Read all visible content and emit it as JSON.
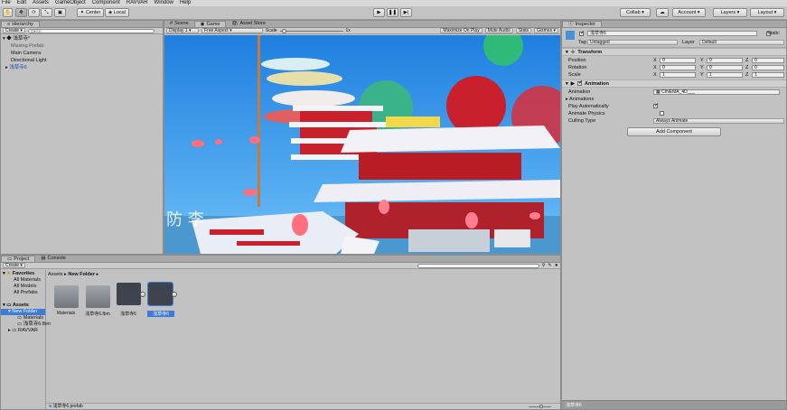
{
  "menu": [
    "File",
    "Edit",
    "Assets",
    "GameObject",
    "Component",
    "RAVVAR",
    "Window",
    "Help"
  ],
  "toolbar": {
    "pivot": "Center",
    "space": "Local",
    "collab": "Collab ▾",
    "account": "Account",
    "layers": "Layers",
    "layout": "Layout"
  },
  "hierarchy": {
    "tab": "Hierarchy",
    "create": "Create",
    "search_placeholder": "Q▾All",
    "scene": "浅草寺*",
    "items": [
      "Missing Prefab",
      "Main Camera",
      "Directional Light",
      "浅草寺6"
    ]
  },
  "scene_tabs": {
    "scene": "Scene",
    "game": "Game",
    "store": "Asset Store"
  },
  "game_bar": {
    "display": "Display 1",
    "aspect": "Free Aspect",
    "scale_label": "Scale",
    "scale_value": "1x",
    "maximize": "Maximize On Play",
    "mute": "Mute Audio",
    "stats": "Stats",
    "gizmos": "Gizmos"
  },
  "inspector": {
    "tab": "Inspector",
    "object_name": "浅草寺6",
    "static": "Static",
    "tag_label": "Tag",
    "tag": "Untagged",
    "layer_label": "Layer",
    "layer": "Default",
    "transform": "Transform",
    "position": "Position",
    "rotation": "Rotation",
    "scale": "Scale",
    "pos": [
      "0",
      "0",
      "0"
    ],
    "rot": [
      "0",
      "0",
      "0"
    ],
    "scl": [
      "1",
      "1",
      "1"
    ],
    "animation": "Animation",
    "anim_field_label": "Animation",
    "anim_field": "CINEMA_4D___",
    "animations": "Animations",
    "play_auto": "Play Automatically",
    "animate_physics": "Animate Physics",
    "culling_label": "Culling Type",
    "culling": "Always Animate",
    "add_component": "Add Component",
    "footer": "浅草寺6"
  },
  "project": {
    "tab_project": "Project",
    "tab_console": "Console",
    "create": "Create",
    "favorites": "Favorites",
    "fav_items": [
      "All Materials",
      "All Models",
      "All Prefabs"
    ],
    "assets": "Assets",
    "tree": [
      "New Folder",
      "Materials",
      "浅草寺6.fbm",
      "RAVVAR"
    ],
    "breadcrumb_root": "Assets",
    "breadcrumb_folder": "New Folder",
    "thumbs": [
      "Materials",
      "浅草寺6.fbm",
      "浅草寺6",
      "浅草寺6"
    ],
    "status": "浅草寺6.prefab"
  },
  "colors": {
    "accent": "#3d7bd5",
    "sky": "#2f91e4",
    "temple_red": "#c9202b"
  }
}
